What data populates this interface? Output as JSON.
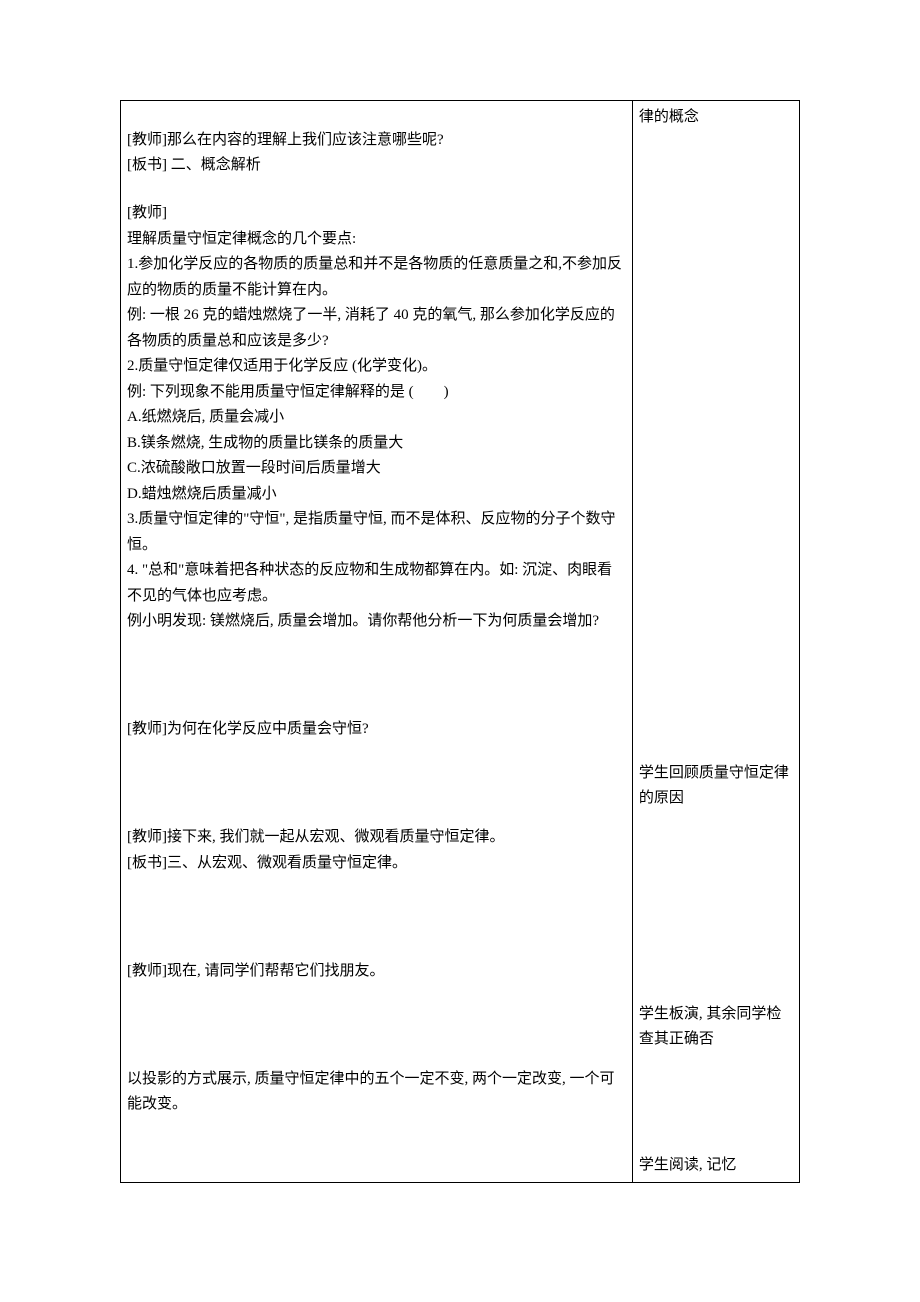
{
  "row1_right": "律的概念",
  "row2_left_line1": "[教师]那么在内容的理解上我们应该注意哪些呢?",
  "row2_left_line2": "[板书] 二、概念解析",
  "row2b_intro": "[教师]",
  "row2b_1": "理解质量守恒定律概念的几个要点:",
  "row2b_2": "1.参加化学反应的各物质的质量总和并不是各物质的任意质量之和,不参加反应的物质的质量不能计算在内。",
  "row2b_3": "例: 一根 26 克的蜡烛燃烧了一半, 消耗了 40 克的氧气, 那么参加化学反应的各物质的质量总和应该是多少?",
  "row2b_4": "2.质量守恒定律仅适用于化学反应 (化学变化)。",
  "row2b_5": "例: 下列现象不能用质量守恒定律解释的是 (　　)",
  "row2b_6": "A.纸燃烧后, 质量会减小",
  "row2b_7": "B.镁条燃烧, 生成物的质量比镁条的质量大",
  "row2b_8": "C.浓硫酸敞口放置一段时间后质量增大",
  "row2b_9": "D.蜡烛燃烧后质量减小",
  "row2b_10": "3.质量守恒定律的\"守恒\", 是指质量守恒, 而不是体积、反应物的分子个数守恒。",
  "row2b_11": "4. \"总和\"意味着把各种状态的反应物和生成物都算在内。如: 沉淀、肉眼看不见的气体也应考虑。",
  "row2b_12": "例小明发现: 镁燃烧后, 质量会增加。请你帮他分析一下为何质量会增加?",
  "row3_left": "[教师]为何在化学反应中质量会守恒?",
  "row3_right": "学生回顾质量守恒定律的原因",
  "row4_left_line1": "[教师]接下来, 我们就一起从宏观、微观看质量守恒定律。",
  "row4_left_line2": "[板书]三、从宏观、微观看质量守恒定律。",
  "row5_left": "[教师]现在, 请同学们帮帮它们找朋友。",
  "row5_right": "学生板演, 其余同学检查其正确否",
  "row6_left": "以投影的方式展示, 质量守恒定律中的五个一定不变, 两个一定改变, 一个可能改变。",
  "row6_right": "学生阅读, 记忆"
}
